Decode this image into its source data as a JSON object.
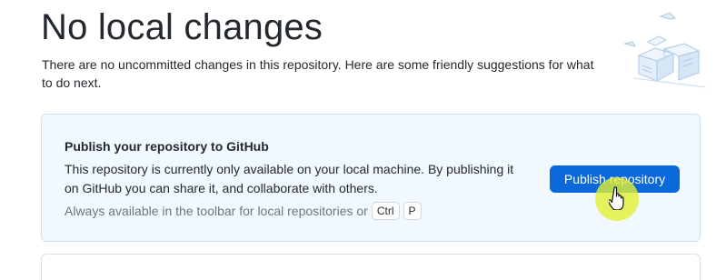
{
  "header": {
    "title": "No local changes",
    "subtitle": "There are no uncommitted changes in this repository. Here are some friendly suggestions for what to do next."
  },
  "illustration": {
    "icon": "empty-boxes-illustration"
  },
  "publish_card": {
    "title": "Publish your repository to GitHub",
    "description": "This repository is currently only available on your local machine. By publishing it on GitHub you can share it, and collaborate with others.",
    "hint_text": "Always available in the toolbar for local repositories or",
    "shortcut_keys": [
      "Ctrl",
      "P"
    ],
    "button_label": "Publish repository"
  },
  "colors": {
    "accent": "#0969da",
    "card_background": "#f1f8ff",
    "cursor_highlight": "#e4f032"
  }
}
